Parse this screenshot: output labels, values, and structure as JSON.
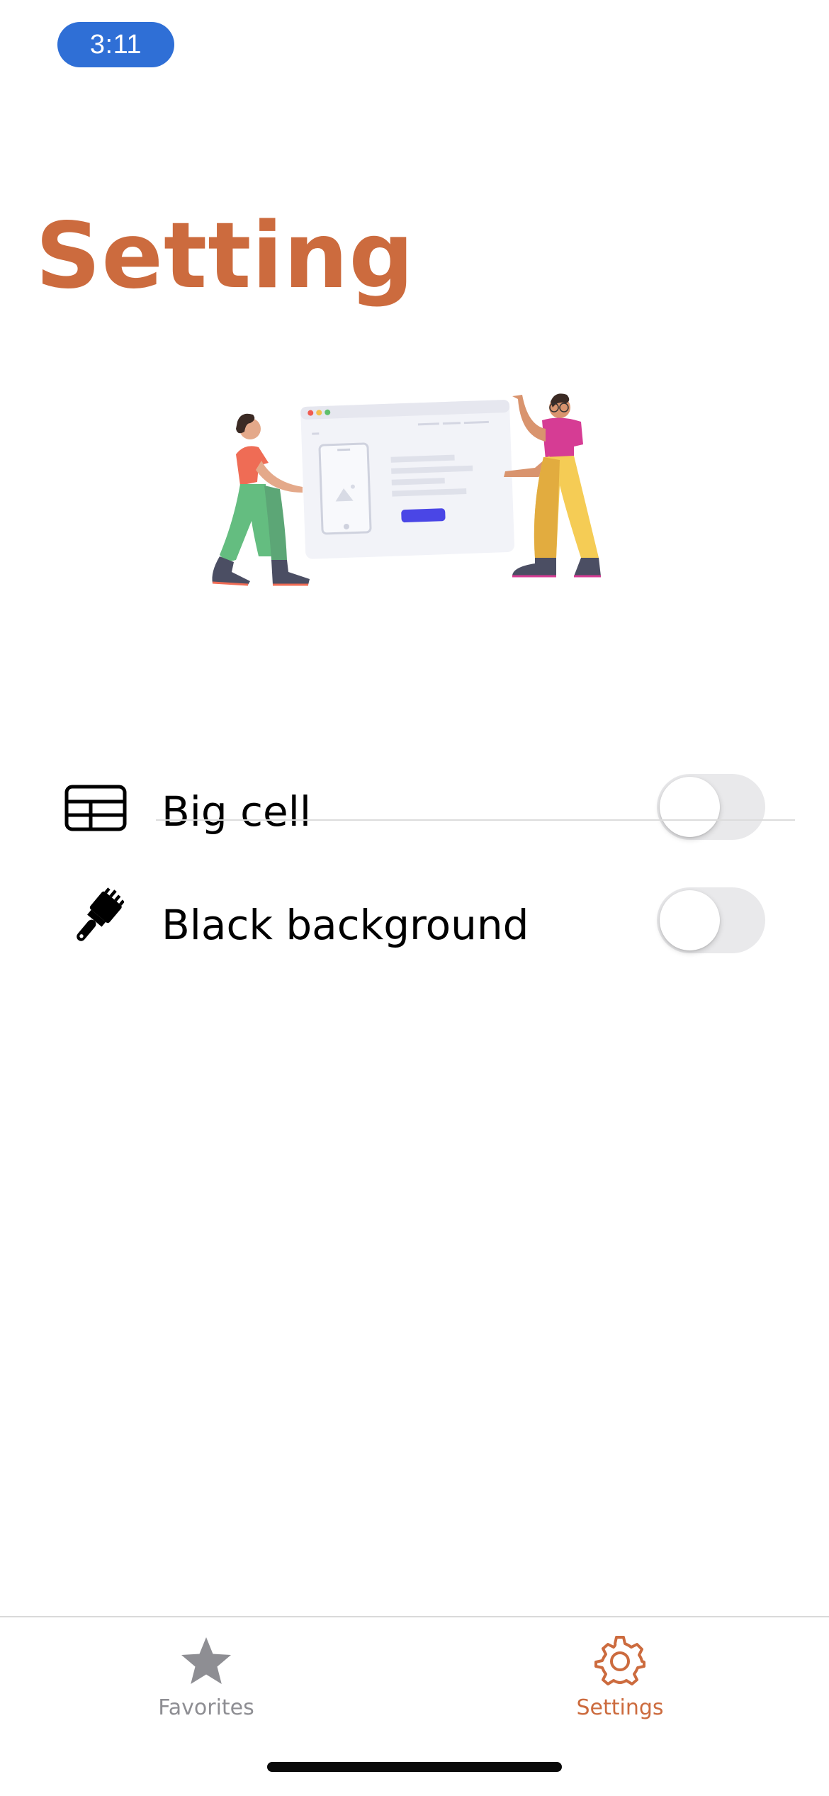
{
  "status_bar": {
    "time": "3:11"
  },
  "page": {
    "title": "Setting",
    "accent_color": "#cc6b3e"
  },
  "settings": [
    {
      "label": "Big cell",
      "icon": "table-grid-icon",
      "enabled": false
    },
    {
      "label": "Black background",
      "icon": "paintbrush-icon",
      "enabled": false
    }
  ],
  "tab_bar": {
    "tabs": [
      {
        "label": "Favorites",
        "icon": "star-icon",
        "selected": false,
        "color": "#8e8e93"
      },
      {
        "label": "Settings",
        "icon": "gear-icon",
        "selected": true,
        "color": "#cc6b3e"
      }
    ]
  }
}
